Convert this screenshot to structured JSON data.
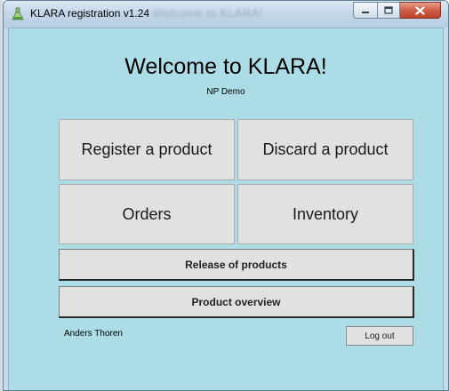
{
  "window": {
    "title": "KLARA registration v1.24",
    "background_title": "Welcome to KLARA!"
  },
  "main": {
    "heading": "Welcome to KLARA!",
    "subheading": "NP Demo",
    "buttons": {
      "register": "Register a product",
      "discard": "Discard a product",
      "orders": "Orders",
      "inventory": "Inventory",
      "release": "Release of products",
      "overview": "Product overview"
    },
    "user_name": "Anders Thoren",
    "logout": "Log out"
  },
  "colors": {
    "client_background": "#acdde6",
    "button_face": "#e1e1e1",
    "close_button": "#c7503a"
  },
  "icons": {
    "app": "flask-icon",
    "minimize": "minimize-icon",
    "maximize": "maximize-icon",
    "close": "close-icon"
  }
}
